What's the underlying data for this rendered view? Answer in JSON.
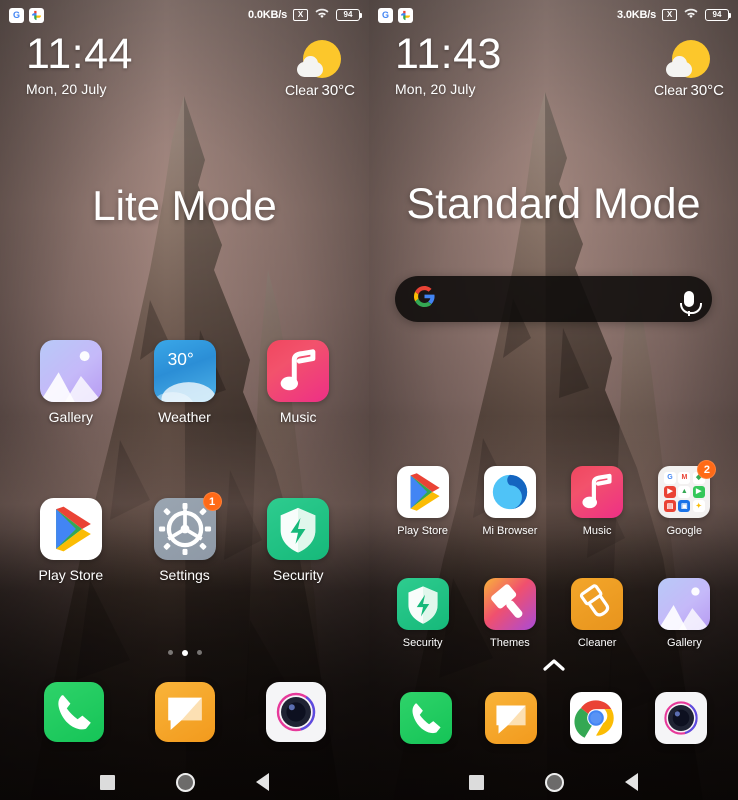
{
  "panels": [
    {
      "mode_title": "Lite Mode",
      "status": {
        "notif_icons": [
          "google-icon",
          "google-photos-icon"
        ],
        "network_speed": "0.0KB/s",
        "signal_label": "X",
        "wifi_icon": "wifi-icon",
        "battery_level": "94"
      },
      "clock": {
        "time": "11:44",
        "date": "Mon, 20 July"
      },
      "weather": {
        "condition": "Clear",
        "temperature": "30°C",
        "icon": "sun-behind-cloud-icon"
      },
      "has_search_bar": false,
      "rows": [
        [
          {
            "label": "Gallery",
            "icon": "gallery-icon",
            "badge": null
          },
          {
            "label": "Weather",
            "icon": "weather-icon",
            "badge": null
          },
          {
            "label": "Music",
            "icon": "music-icon",
            "badge": null
          }
        ],
        [
          {
            "label": "Play Store",
            "icon": "play-store-icon",
            "badge": null
          },
          {
            "label": "Settings",
            "icon": "settings-icon",
            "badge": "1"
          },
          {
            "label": "Security",
            "icon": "security-icon",
            "badge": null
          }
        ]
      ],
      "page_dots": {
        "count": 3,
        "active_index": 1
      },
      "dock": [
        {
          "label": "Phone",
          "icon": "phone-icon"
        },
        {
          "label": "Messages",
          "icon": "messages-icon"
        },
        {
          "label": "Camera",
          "icon": "camera-icon"
        }
      ],
      "navbar": [
        "recents-button",
        "home-button",
        "back-button"
      ]
    },
    {
      "mode_title": "Standard Mode",
      "status": {
        "notif_icons": [
          "google-icon",
          "google-photos-icon"
        ],
        "network_speed": "3.0KB/s",
        "signal_label": "X",
        "wifi_icon": "wifi-icon",
        "battery_level": "94"
      },
      "clock": {
        "time": "11:43",
        "date": "Mon, 20 July"
      },
      "weather": {
        "condition": "Clear",
        "temperature": "30°C",
        "icon": "sun-behind-cloud-icon"
      },
      "has_search_bar": true,
      "search_bar": {
        "logo": "google-g-icon",
        "mic": "microphone-icon",
        "placeholder": ""
      },
      "rows": [
        [
          {
            "label": "Play Store",
            "icon": "play-store-icon",
            "badge": null
          },
          {
            "label": "Mi Browser",
            "icon": "mi-browser-icon",
            "badge": null
          },
          {
            "label": "Music",
            "icon": "music-icon",
            "badge": null
          },
          {
            "label": "Google",
            "icon": "google-folder-icon",
            "badge": "2"
          }
        ],
        [
          {
            "label": "Security",
            "icon": "security-icon",
            "badge": null
          },
          {
            "label": "Themes",
            "icon": "themes-icon",
            "badge": null
          },
          {
            "label": "Cleaner",
            "icon": "cleaner-icon",
            "badge": null
          },
          {
            "label": "Gallery",
            "icon": "gallery-icon",
            "badge": null
          }
        ]
      ],
      "drawer_arrow": "chevron-up-icon",
      "dock": [
        {
          "label": "Phone",
          "icon": "phone-icon"
        },
        {
          "label": "Messages",
          "icon": "messages-icon"
        },
        {
          "label": "Chrome",
          "icon": "chrome-icon"
        },
        {
          "label": "Camera",
          "icon": "camera-icon"
        }
      ],
      "navbar": [
        "recents-button",
        "home-button",
        "back-button"
      ]
    }
  ],
  "colors": {
    "accent_orange": "#ff6a17",
    "security_green": "#16b97a",
    "weather_blue": "#2b8ed6",
    "music_pink": "#ee2f86",
    "sun_yellow": "#fcc72b",
    "wallpaper_sky": "#9a817a"
  }
}
